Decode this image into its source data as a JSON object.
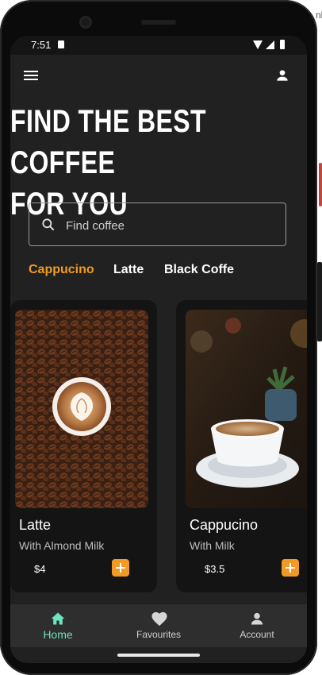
{
  "status_bar": {
    "time": "7:51"
  },
  "edge_text": "nk",
  "headline": {
    "line1": "Find the best coffee",
    "line2": "for you"
  },
  "search": {
    "placeholder": "Find coffee",
    "value": ""
  },
  "tabs": [
    {
      "label": "Cappucino",
      "active": true
    },
    {
      "label": "Latte",
      "active": false
    },
    {
      "label": "Black Coffe",
      "active": false
    }
  ],
  "products": [
    {
      "name": "Latte",
      "description": "With Almond Milk",
      "price": "$4"
    },
    {
      "name": "Cappucino",
      "description": "With Milk",
      "price": "$3.5"
    }
  ],
  "bottom_nav": [
    {
      "label": "Home",
      "icon": "home-icon",
      "active": true
    },
    {
      "label": "Favourites",
      "icon": "heart-icon",
      "active": false
    },
    {
      "label": "Account",
      "icon": "person-icon",
      "active": false
    }
  ],
  "colors": {
    "accent": "#f19a25",
    "nav_active": "#6fe2c0",
    "background": "#212121"
  }
}
